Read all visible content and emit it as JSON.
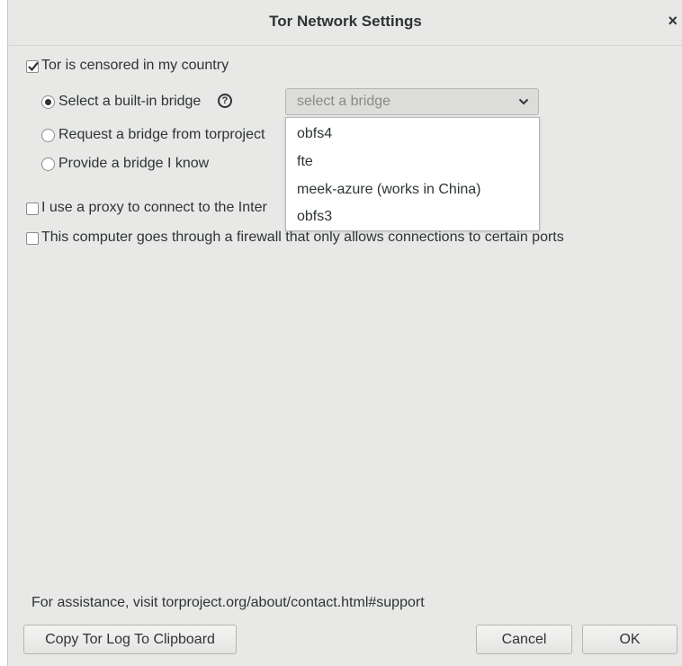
{
  "dialog": {
    "title": "Tor Network Settings",
    "close_label": "×"
  },
  "censored": {
    "label": "Tor is censored in my country",
    "checked": true
  },
  "bridge_options": {
    "builtin_label": "Select a built-in bridge",
    "help_glyph": "?",
    "request_label": "Request a bridge from torproject",
    "provide_label": "Provide a bridge I know",
    "selected": "builtin"
  },
  "bridge_select": {
    "placeholder": "select a bridge",
    "options": [
      "obfs4",
      "fte",
      "meek-azure (works in China)",
      "obfs3"
    ]
  },
  "proxy": {
    "label": "I use a proxy to connect to the Inter",
    "checked": false
  },
  "firewall": {
    "label": "This computer goes through a firewall that only allows connections to certain ports",
    "checked": false
  },
  "footer": {
    "assistance": "For assistance, visit torproject.org/about/contact.html#support",
    "copy_log_label": "Copy Tor Log To Clipboard",
    "cancel_label": "Cancel",
    "ok_label": "OK"
  },
  "icons": {
    "checkmark": "check-icon",
    "help": "help-icon",
    "chevron": "chevron-down-icon",
    "close": "close-icon"
  }
}
